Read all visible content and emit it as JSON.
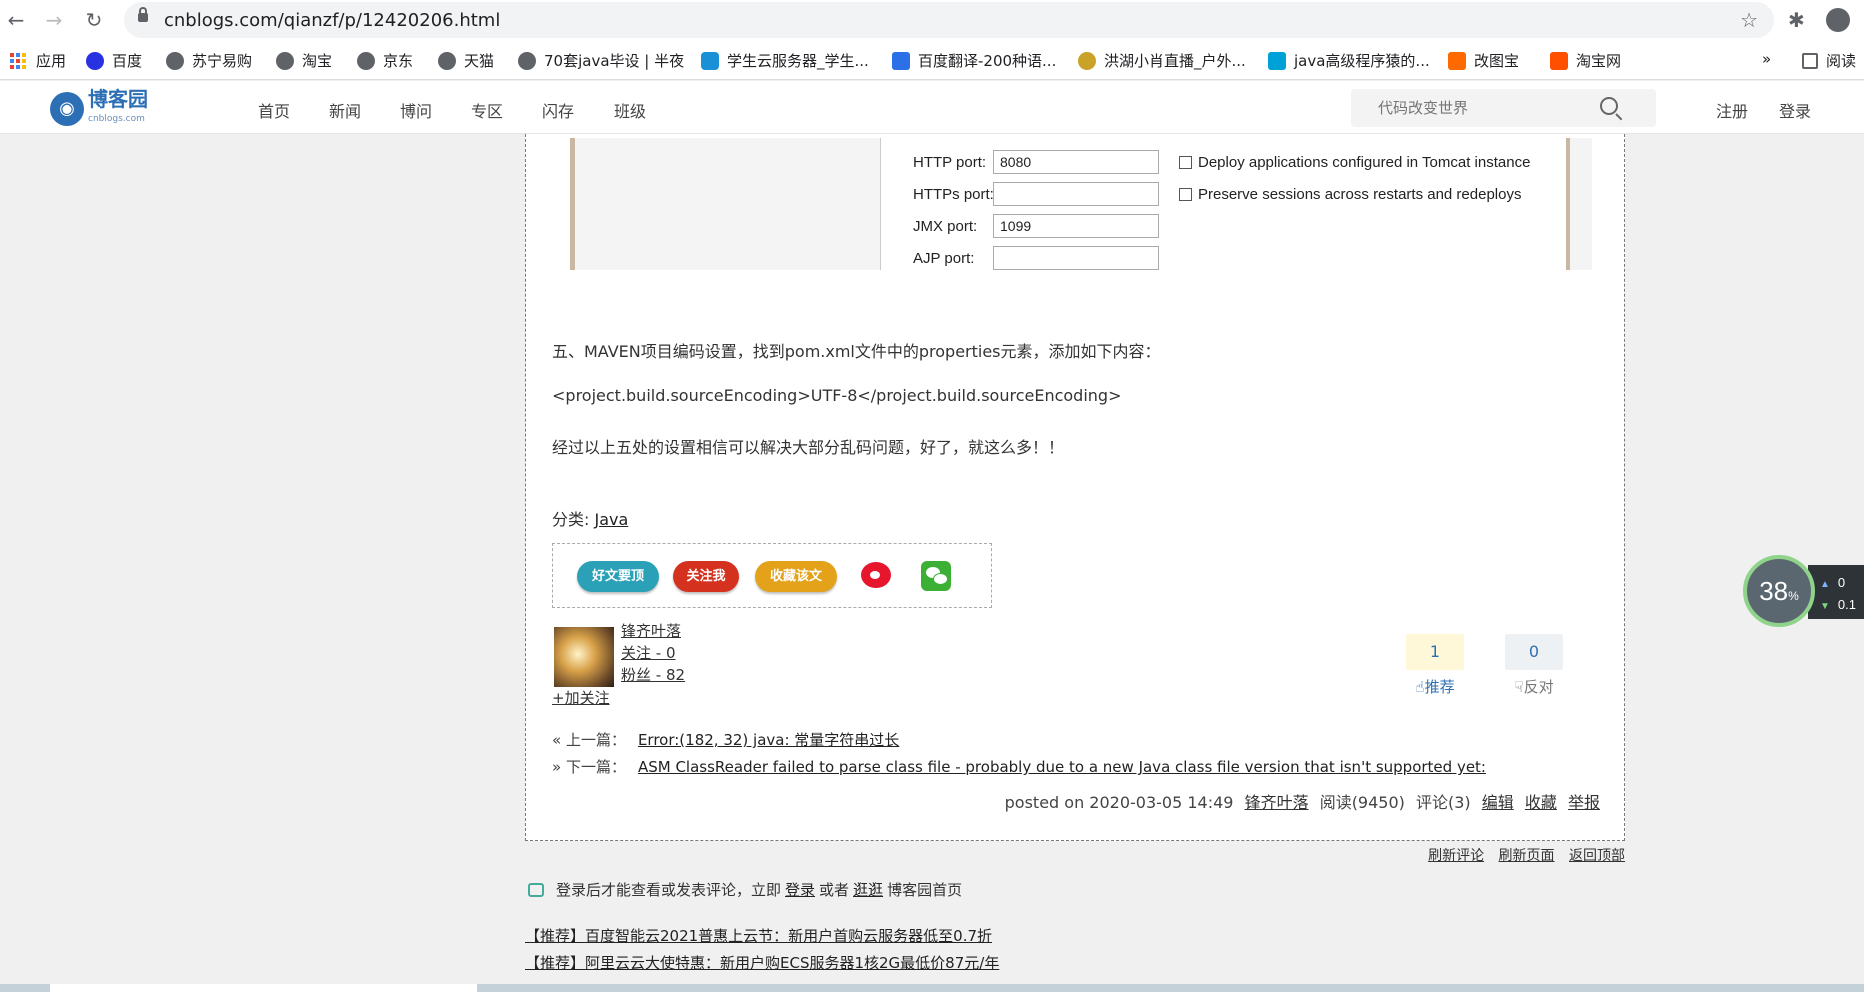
{
  "browser": {
    "url": "cnblogs.com/qianzf/p/12420206.html",
    "bookmarks": [
      {
        "label": "应用",
        "icon": "apps-grid-icon"
      },
      {
        "label": "百度",
        "icon": "baidu-icon",
        "color": "#2932e1"
      },
      {
        "label": "苏宁易购",
        "icon": "globe-icon",
        "color": "#5f6368"
      },
      {
        "label": "淘宝",
        "icon": "globe-icon",
        "color": "#5f6368"
      },
      {
        "label": "京东",
        "icon": "globe-icon",
        "color": "#5f6368"
      },
      {
        "label": "天猫",
        "icon": "globe-icon",
        "color": "#5f6368"
      },
      {
        "label": "70套java毕设 | 半夜",
        "icon": "globe-icon",
        "color": "#5f6368"
      },
      {
        "label": "学生云服务器_学生...",
        "icon": "cloud-icon",
        "color": "#1a91d6"
      },
      {
        "label": "百度翻译-200种语...",
        "icon": "translate-icon",
        "color": "#2c6fe6"
      },
      {
        "label": "洪湖小肖直播_户外...",
        "icon": "bee-icon",
        "color": "#c9a227"
      },
      {
        "label": "java高级程序猿的...",
        "icon": "bilibili-icon",
        "color": "#00a1d6"
      },
      {
        "label": "改图宝",
        "icon": "gaitubao-icon",
        "color": "#ff6a00"
      },
      {
        "label": "淘宝网",
        "icon": "taobao-icon",
        "color": "#ff5000"
      }
    ],
    "more_bookmarks": "»",
    "reading_list": "阅读"
  },
  "site": {
    "logo_text": "博客园",
    "logo_sub": "cnblogs.com",
    "nav": [
      "首页",
      "新闻",
      "博问",
      "专区",
      "闪存",
      "班级"
    ],
    "search_placeholder": "代码改变世界",
    "register": "注册",
    "login": "登录"
  },
  "screenshot": {
    "rows": [
      {
        "label": "HTTP port:",
        "value": "8080",
        "check": "Deploy applications configured in Tomcat instance"
      },
      {
        "label": "HTTPs port:",
        "value": "",
        "check": "Preserve sessions across restarts and redeploys"
      },
      {
        "label": "JMX port:",
        "value": "1099",
        "check": ""
      },
      {
        "label": "AJP port:",
        "value": "",
        "check": ""
      }
    ]
  },
  "article": {
    "para1": "五、MAVEN项目编码设置，找到pom.xml文件中的properties元素，添加如下内容：",
    "para2": "<project.build.sourceEncoding>UTF-8</project.build.sourceEncoding>",
    "para3": "经过以上五处的设置相信可以解决大部分乱码问题，好了，就这么多！！",
    "category_label": "分类: ",
    "category": "Java"
  },
  "share": {
    "buttons": [
      {
        "label": "好文要顶",
        "color": "#2aa1b6"
      },
      {
        "label": "关注我",
        "color": "#d4321f"
      },
      {
        "label": "收藏该文",
        "color": "#e3a21a"
      }
    ]
  },
  "author": {
    "name": "锋齐叶落",
    "following": "关注 - 0",
    "followers": "粉丝 - 82",
    "follow_action": "+加关注"
  },
  "votes": {
    "digg": {
      "count": "1",
      "label": "推荐"
    },
    "bury": {
      "count": "0",
      "label": "反对"
    }
  },
  "navigation": {
    "prev_label": "« 上一篇：",
    "prev_title": "Error:(182, 32) java: 常量字符串过长",
    "next_label": "» 下一篇：",
    "next_title": "ASM ClassReader failed to parse class file - probably due to a new Java class file version that isn't supported yet:"
  },
  "postmeta": {
    "posted": "posted on 2020-03-05 14:49",
    "author": "锋齐叶落",
    "views": "阅读(9450)",
    "comments": "评论(3)",
    "edit": "编辑",
    "collect": "收藏",
    "report": "举报"
  },
  "after_links": [
    "刷新评论",
    "刷新页面",
    "返回顶部"
  ],
  "login_tip": {
    "prefix": "登录后才能查看或发表评论，立即",
    "login": "登录",
    "middle": "或者",
    "browse": "逛逛",
    "suffix": "博客园首页"
  },
  "promos": [
    "【推荐】百度智能云2021普惠上云节：新用户首购云服务器低至0.7折",
    "【推荐】阿里云云大使特惠：新用户购ECS服务器1核2G最低价87元/年"
  ],
  "speed_widget": {
    "percent": "38",
    "percent_sign": "%",
    "up": "0",
    "down": "0.1",
    "ring_color": "#8fd48a"
  }
}
